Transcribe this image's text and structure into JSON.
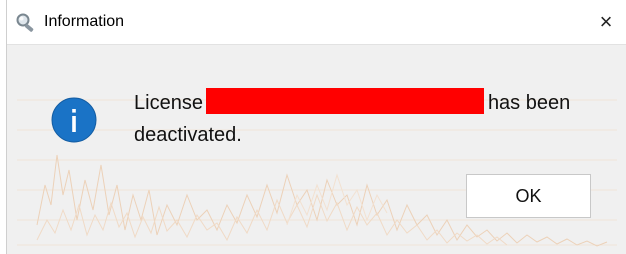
{
  "window": {
    "title": "Information",
    "close_glyph": "×",
    "title_icon": "magnifier-icon"
  },
  "message": {
    "icon": "info-icon",
    "prefix": "License",
    "suffix": "has been",
    "line2": "deactivated."
  },
  "buttons": {
    "ok_label": "OK"
  },
  "colors": {
    "redaction": "#ff0000",
    "info_blue": "#1a73c6",
    "background": "#f0f0f0"
  }
}
